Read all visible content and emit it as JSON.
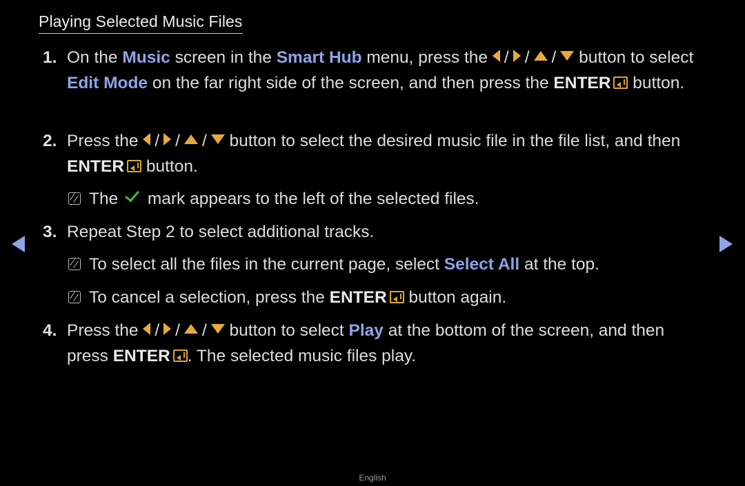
{
  "section_title": "Playing Selected Music Files",
  "steps": [
    {
      "number": "1.",
      "parts": {
        "a": "On the ",
        "b": "Music",
        "c": " screen in the ",
        "d": "Smart Hub",
        "e": " menu, press the ",
        "f": " button to select ",
        "g": "Edit Mode",
        "h": " on the far right side of the screen, and then press the ",
        "i": "ENTER",
        "j": " button."
      }
    },
    {
      "number": "2.",
      "parts": {
        "a": "Press the ",
        "b": " button to select the desired music file in the file list, and then ",
        "c": "ENTER",
        "d": " button."
      }
    },
    {
      "number": "3.",
      "text": "Repeat Step 2 to select additional tracks."
    },
    {
      "number": "4.",
      "parts": {
        "a": "Press the ",
        "b": " button to select ",
        "c": "Play",
        "d": " at the bottom of the screen, and then press ",
        "e": "ENTER",
        "f": ". The selected music files play."
      }
    }
  ],
  "notes": [
    {
      "a": "The ",
      "b": " mark appears to the left of the selected files."
    },
    {
      "a": "To select all the files in the current page, select ",
      "b": "Select All",
      "c": " at the top."
    },
    {
      "a": "To cancel a selection, press the ",
      "b": "ENTER",
      "c": " button again."
    }
  ],
  "slash": "/",
  "nav": {
    "prev": "previous-page",
    "next": "next-page"
  },
  "footer_language": "English",
  "colors": {
    "highlight": "#8fa3e6",
    "arrow_key": "#e6ab3a",
    "check": "#3ec23a",
    "background": "#000000"
  }
}
